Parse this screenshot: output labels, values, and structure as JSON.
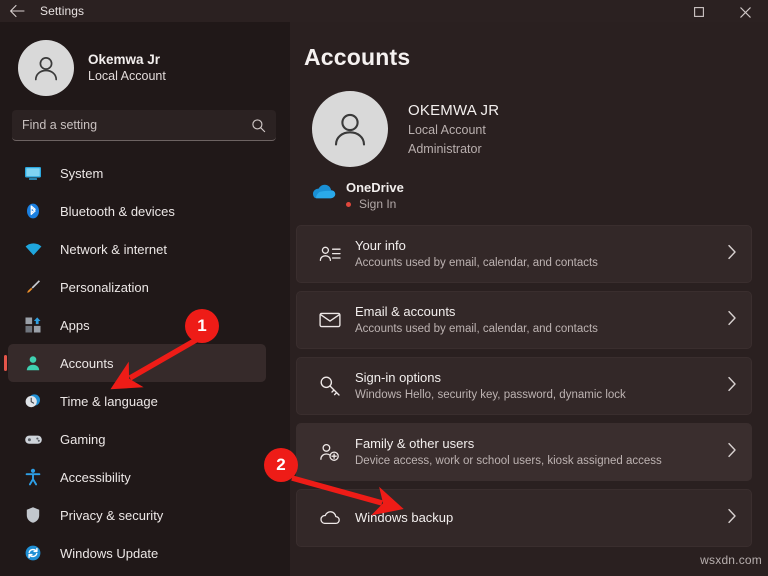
{
  "window": {
    "title": "Settings",
    "back_icon": "back-arrow-icon",
    "maximize_icon": "maximize-icon",
    "close_icon": "close-icon"
  },
  "sidebar": {
    "profile": {
      "name": "Okemwa Jr",
      "account_type": "Local Account",
      "avatar_icon": "person-avatar-icon"
    },
    "search": {
      "placeholder": "Find a setting",
      "value": "",
      "icon": "search-icon"
    },
    "items": [
      {
        "label": "System",
        "icon": "monitor-icon",
        "selected": false
      },
      {
        "label": "Bluetooth & devices",
        "icon": "bluetooth-icon",
        "selected": false
      },
      {
        "label": "Network & internet",
        "icon": "wifi-icon",
        "selected": false
      },
      {
        "label": "Personalization",
        "icon": "paintbrush-icon",
        "selected": false
      },
      {
        "label": "Apps",
        "icon": "apps-grid-icon",
        "selected": false
      },
      {
        "label": "Accounts",
        "icon": "person-icon",
        "selected": true
      },
      {
        "label": "Time & language",
        "icon": "clock-icon",
        "selected": false
      },
      {
        "label": "Gaming",
        "icon": "gamepad-icon",
        "selected": false
      },
      {
        "label": "Accessibility",
        "icon": "accessibility-icon",
        "selected": false
      },
      {
        "label": "Privacy & security",
        "icon": "shield-icon",
        "selected": false
      },
      {
        "label": "Windows Update",
        "icon": "update-refresh-icon",
        "selected": false
      }
    ],
    "accent_color": "#e4554a"
  },
  "main": {
    "page_title": "Accounts",
    "account": {
      "name": "OKEMWA JR",
      "type": "Local Account",
      "role": "Administrator",
      "avatar_icon": "person-avatar-icon"
    },
    "onedrive": {
      "title": "OneDrive",
      "status": "Sign In",
      "icon": "onedrive-cloud-icon",
      "status_dot_color": "#e0473c"
    },
    "cards": [
      {
        "title": "Your info",
        "subtitle": "Accounts used by email, calendar, and contacts",
        "icon": "contact-card-icon",
        "chevron": "chevron-right-icon",
        "highlighted": false
      },
      {
        "title": "Email & accounts",
        "subtitle": "Accounts used by email, calendar, and contacts",
        "icon": "envelope-icon",
        "chevron": "chevron-right-icon",
        "highlighted": false
      },
      {
        "title": "Sign-in options",
        "subtitle": "Windows Hello, security key, password, dynamic lock",
        "icon": "key-icon",
        "chevron": "chevron-right-icon",
        "highlighted": false
      },
      {
        "title": "Family & other users",
        "subtitle": "Device access, work or school users, kiosk assigned access",
        "icon": "add-user-icon",
        "chevron": "chevron-right-icon",
        "highlighted": true
      },
      {
        "title": "Windows backup",
        "subtitle": "",
        "icon": "backup-cloud-icon",
        "chevron": "chevron-right-icon",
        "highlighted": false
      }
    ]
  },
  "annotations": {
    "color": "#ee1c17",
    "steps": [
      {
        "number": "1",
        "target": "Accounts"
      },
      {
        "number": "2",
        "target": "Family & other users"
      }
    ]
  },
  "watermark": "wsxdn.com"
}
